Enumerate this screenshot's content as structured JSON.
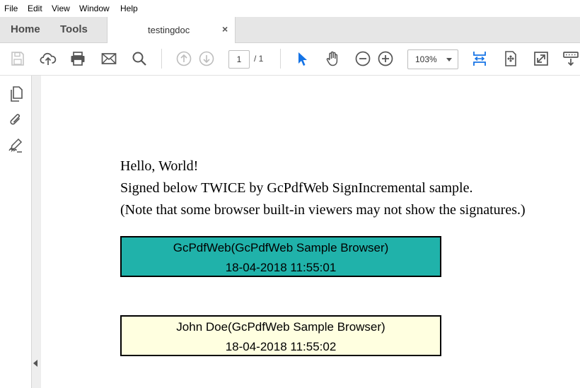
{
  "menu": [
    "File",
    "Edit",
    "View",
    "Window",
    "Help"
  ],
  "tabs": {
    "home": "Home",
    "tools": "Tools",
    "document": "testingdoc",
    "close_symbol": "×"
  },
  "toolbar": {
    "page_current": "1",
    "page_total": "/ 1",
    "zoom": "103%"
  },
  "document": {
    "lines": [
      "Hello, World!",
      "Signed below TWICE by GcPdfWeb SignIncremental sample.",
      "(Note that some browser built-in viewers may not show the signatures.)"
    ],
    "signatures": [
      {
        "name": "GcPdfWeb(GcPdfWeb Sample Browser)",
        "date": "18-04-2018 11:55:01",
        "color": "#20b2aa"
      },
      {
        "name": "John Doe(GcPdfWeb Sample Browser)",
        "date": "18-04-2018 11:55:02",
        "color": "#ffffe0"
      }
    ]
  },
  "colors": {
    "accent_blue": "#1473e6",
    "icon_gray": "#6e6e6e"
  }
}
